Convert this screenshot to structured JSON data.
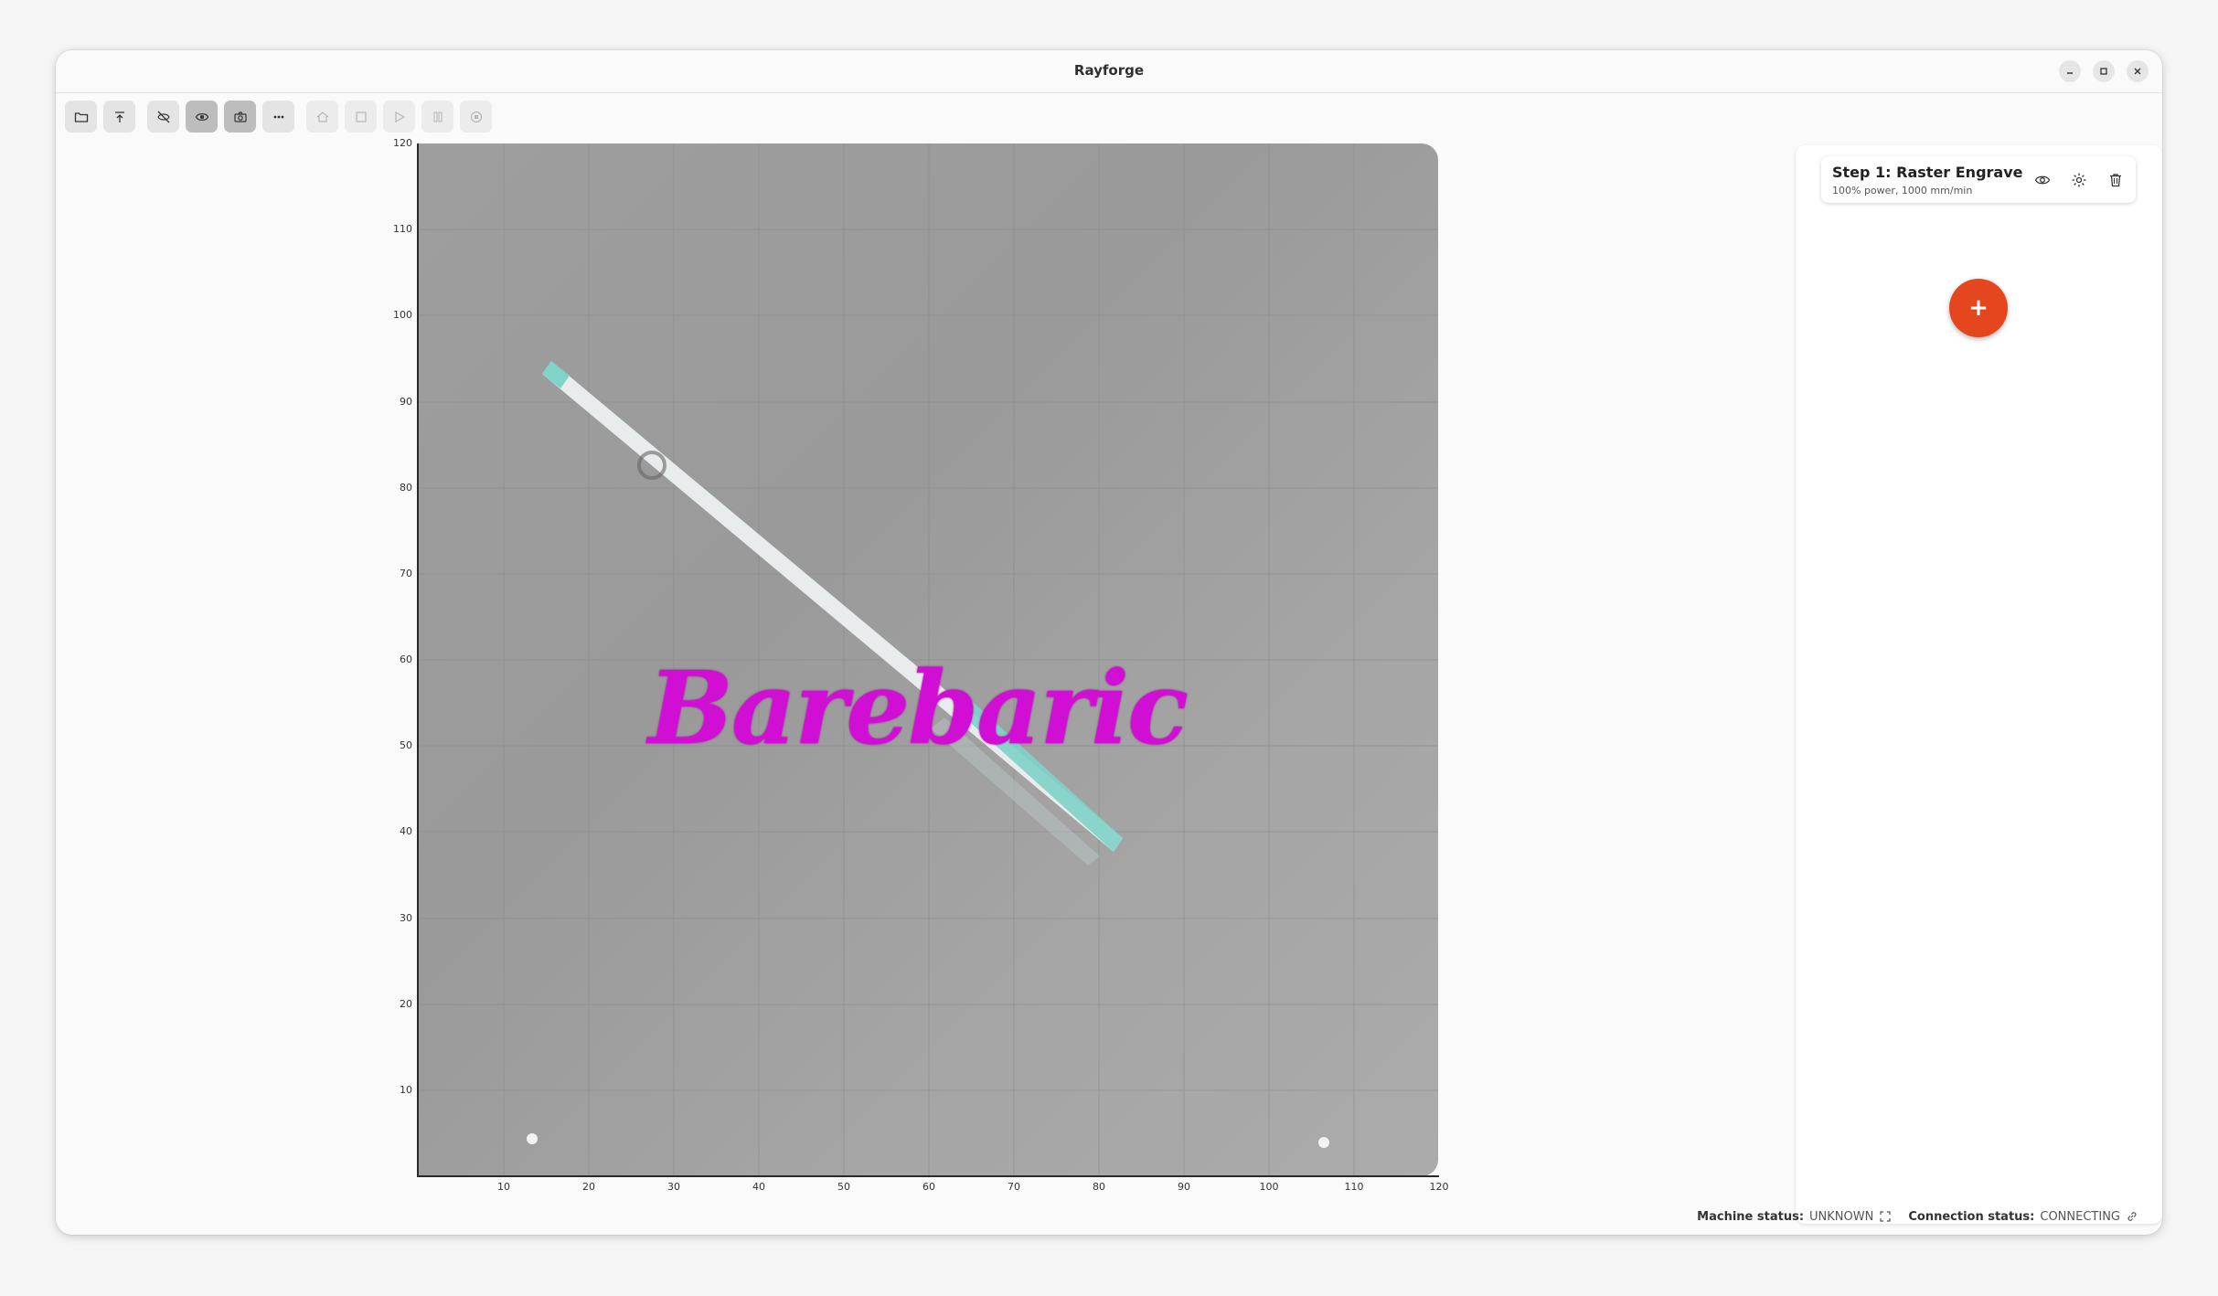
{
  "window": {
    "title": "Rayforge"
  },
  "toolbar": {
    "buttons": [
      {
        "icon": "folder-open-icon",
        "state": "normal"
      },
      {
        "icon": "upload-icon",
        "state": "normal"
      },
      {
        "icon": "visibility-off-icon",
        "state": "normal"
      },
      {
        "icon": "eye-icon",
        "state": "active"
      },
      {
        "icon": "camera-icon",
        "state": "active"
      },
      {
        "icon": "more-icon",
        "state": "normal"
      },
      {
        "icon": "home-icon",
        "state": "disabled"
      },
      {
        "icon": "frame-icon",
        "state": "disabled"
      },
      {
        "icon": "play-icon",
        "state": "disabled"
      },
      {
        "icon": "pause-icon",
        "state": "disabled"
      },
      {
        "icon": "stop-icon",
        "state": "disabled"
      }
    ]
  },
  "canvas": {
    "y_ticks": [
      "120",
      "110",
      "100",
      "90",
      "80",
      "70",
      "60",
      "50",
      "40",
      "30",
      "20",
      "10"
    ],
    "x_ticks": [
      "10",
      "20",
      "30",
      "40",
      "50",
      "60",
      "70",
      "80",
      "90",
      "100",
      "110",
      "120"
    ],
    "engrave_text": "Barebaric",
    "engrave_color": "#d10fd4"
  },
  "steps": [
    {
      "title": "Step 1: Raster Engrave",
      "subtitle": "100% power, 1000 mm/min"
    }
  ],
  "add_button": {
    "label": "+",
    "color": "#e5461e"
  },
  "status": {
    "machine_label": "Machine status:",
    "machine_value": "UNKNOWN",
    "connection_label": "Connection status:",
    "connection_value": "CONNECTING"
  }
}
